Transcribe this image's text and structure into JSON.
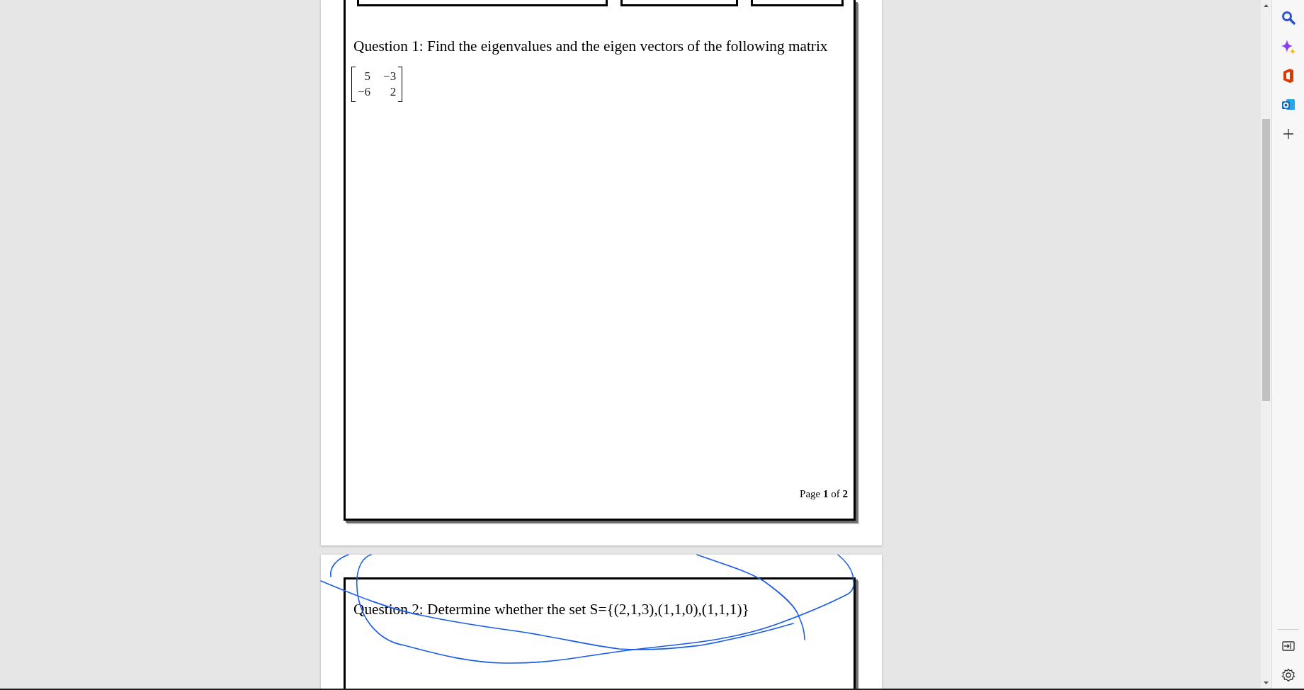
{
  "pages": [
    {
      "question": "Question 1: Find the eigenvalues and the eigen vectors of the following matrix",
      "matrix": [
        [
          "5",
          "−3"
        ],
        [
          "−6",
          "2"
        ]
      ],
      "footer": "Page **1** of **2**"
    },
    {
      "question": "Question 2: Determine whether the set S={(2,1,3),(1,1,0),(1,1,1)}"
    }
  ]
}
